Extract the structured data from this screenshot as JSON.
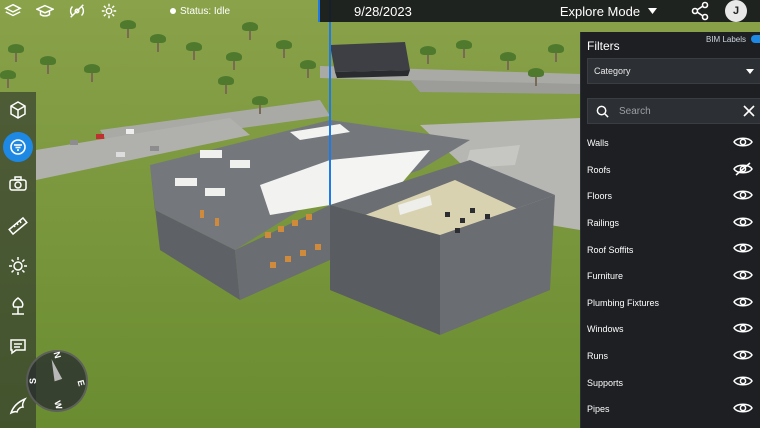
{
  "topbar": {
    "status_label": "Status: Idle"
  },
  "datebar": {
    "date": "9/28/2023",
    "mode": "Explore Mode",
    "avatar_initial": "J"
  },
  "filters": {
    "title": "Filters",
    "bim_labels": "BIM Labels",
    "category": "Category",
    "search_placeholder": "Search",
    "items": [
      {
        "label": "Walls",
        "visible": true
      },
      {
        "label": "Roofs",
        "visible": false
      },
      {
        "label": "Floors",
        "visible": true
      },
      {
        "label": "Railings",
        "visible": true
      },
      {
        "label": "Roof Soffits",
        "visible": true
      },
      {
        "label": "Furniture",
        "visible": true
      },
      {
        "label": "Plumbing Fixtures",
        "visible": true
      },
      {
        "label": "Windows",
        "visible": true
      },
      {
        "label": "Runs",
        "visible": true
      },
      {
        "label": "Supports",
        "visible": true
      },
      {
        "label": "Pipes",
        "visible": true
      }
    ]
  },
  "compass": {
    "n": "N",
    "e": "E",
    "s": "S",
    "w": "W"
  },
  "colors": {
    "accent": "#1e88e5",
    "panel": "#1d1f22",
    "grass": "#6f8f3a"
  }
}
